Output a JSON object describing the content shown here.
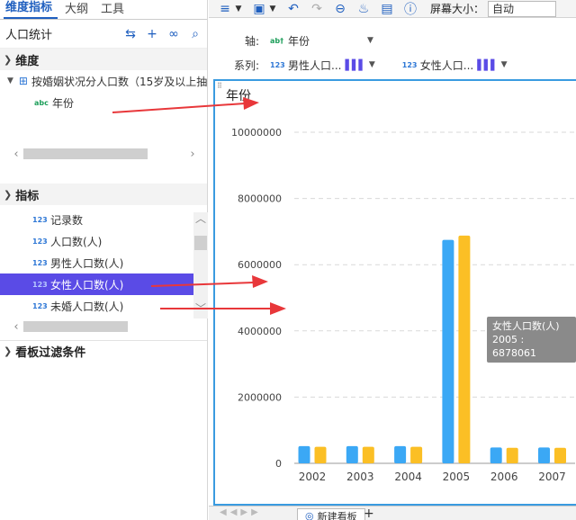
{
  "left_panel": {
    "tabs": [
      {
        "label": "维度指标",
        "active": true
      },
      {
        "label": "大纲",
        "active": false
      },
      {
        "label": "工具",
        "active": false
      }
    ],
    "dataset_title": "人口统计",
    "dimension_section": "维度",
    "table_name": "按婚姻状况分人口数（15岁及以上抽样",
    "dimension_field": "年份",
    "indicator_section": "指标",
    "indicators": [
      {
        "label": "记录数",
        "selected": false
      },
      {
        "label": "人口数(人)",
        "selected": false
      },
      {
        "label": "男性人口数(人)",
        "selected": false
      },
      {
        "label": "女性人口数(人)",
        "selected": true
      },
      {
        "label": "未婚人口数(人)",
        "selected": false
      }
    ],
    "filter_section": "看板过滤条件",
    "badge_num": "123",
    "badge_abc": "abc"
  },
  "toolbar": {
    "screen_size_label": "屏幕大小：",
    "screen_size_value": "自动"
  },
  "config": {
    "axis_label": "轴:",
    "axis_field": "年份",
    "series_label": "系列:",
    "series_fields": [
      "男性人口...",
      "女性人口..."
    ],
    "badge_num": "123",
    "badge_abt": "ab†"
  },
  "chart_data": {
    "type": "bar",
    "title": "年份",
    "categories": [
      "2002",
      "2003",
      "2004",
      "2005",
      "2006",
      "2007"
    ],
    "series": [
      {
        "name": "男性人口数(人)",
        "color": "#3ba8f5",
        "values": [
          520000,
          520000,
          520000,
          6750000,
          480000,
          480000
        ]
      },
      {
        "name": "女性人口数(人)",
        "color": "#fbbf25",
        "values": [
          500000,
          500000,
          500000,
          6878061,
          470000,
          470000
        ]
      }
    ],
    "ylim": [
      0,
      10000000
    ],
    "yticks": [
      0,
      2000000,
      4000000,
      6000000,
      8000000,
      10000000
    ],
    "grid": true,
    "tooltip": {
      "series": "女性人口数(人)",
      "text": "2005 : 6878061"
    }
  },
  "bottom": {
    "tab_label": "新建看板"
  },
  "colors": {
    "accent": "#1f5fbf",
    "selection": "#5a4be6",
    "chart_border": "#3a9be0",
    "arrow": "#e8373a"
  }
}
